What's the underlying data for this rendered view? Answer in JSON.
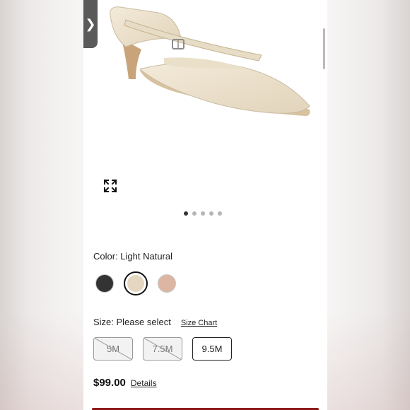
{
  "product": {
    "color_label": "Color: Light Natural",
    "colors": [
      {
        "name": "black",
        "hex": "#333333"
      },
      {
        "name": "light-natural",
        "hex": "#e4d6c0",
        "selected": true
      },
      {
        "name": "blush",
        "hex": "#ddb5a3"
      }
    ],
    "size_label": "Size: Please select",
    "size_chart_label": "Size Chart",
    "sizes": [
      {
        "label": "5M",
        "available": false
      },
      {
        "label": "7.5M",
        "available": false
      },
      {
        "label": "9.5M",
        "available": true
      }
    ],
    "price": "$99.00",
    "details_label": "Details"
  },
  "gallery": {
    "current_index": 1,
    "total": 5
  },
  "icons": {
    "back": "chevron-right-icon",
    "expand": "expand-icon"
  },
  "colors": {
    "cta": "#8e1b1b"
  }
}
